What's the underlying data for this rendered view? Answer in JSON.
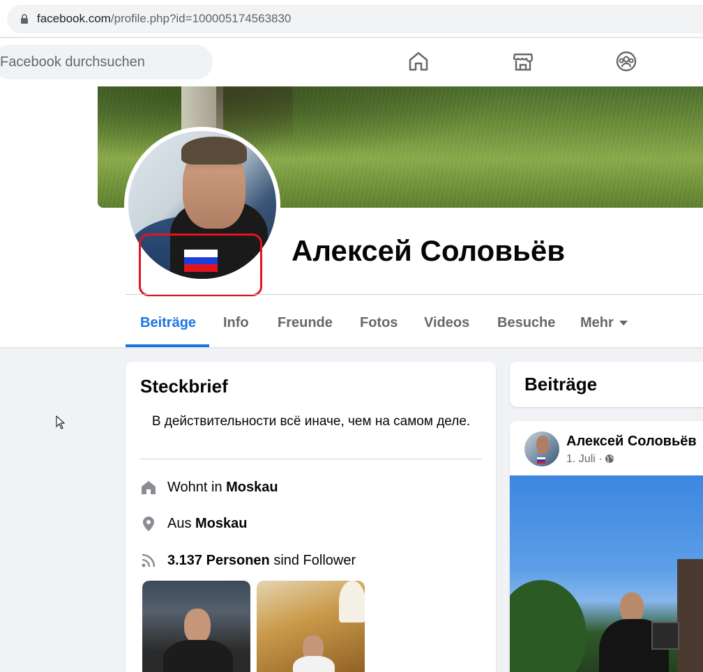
{
  "browser": {
    "url_host": "facebook.com",
    "url_path": "/profile.php?id=100005174563830"
  },
  "nav": {
    "search_placeholder": "Facebook durchsuchen",
    "icons": [
      "home-icon",
      "marketplace-icon",
      "groups-icon"
    ]
  },
  "profile": {
    "name": "Алексей Соловьёв",
    "flag_colors": [
      "#ffffff",
      "#1c3fd9",
      "#e4141e"
    ],
    "highlight_color": "#e4141e"
  },
  "tabs": [
    {
      "label": "Beiträge",
      "active": true
    },
    {
      "label": "Info",
      "active": false
    },
    {
      "label": "Freunde",
      "active": false
    },
    {
      "label": "Fotos",
      "active": false
    },
    {
      "label": "Videos",
      "active": false
    },
    {
      "label": "Besuche",
      "active": false
    },
    {
      "label": "Mehr",
      "active": false
    }
  ],
  "intro": {
    "title": "Steckbrief",
    "bio": "В действительности всё иначе, чем на самом деле.",
    "lives_prefix": "Wohnt in",
    "lives_city": "Moskau",
    "from_prefix": "Aus",
    "from_city": "Moskau",
    "followers_count": "3.137 Personen",
    "followers_suffix": "sind Follower"
  },
  "posts": {
    "title": "Beiträge",
    "post_author": "Алексей Соловьёв",
    "post_date": "1. Juli ·"
  },
  "colors": {
    "accent": "#1b74e4",
    "background": "#f0f2f5",
    "secondary_text": "#65676b"
  }
}
